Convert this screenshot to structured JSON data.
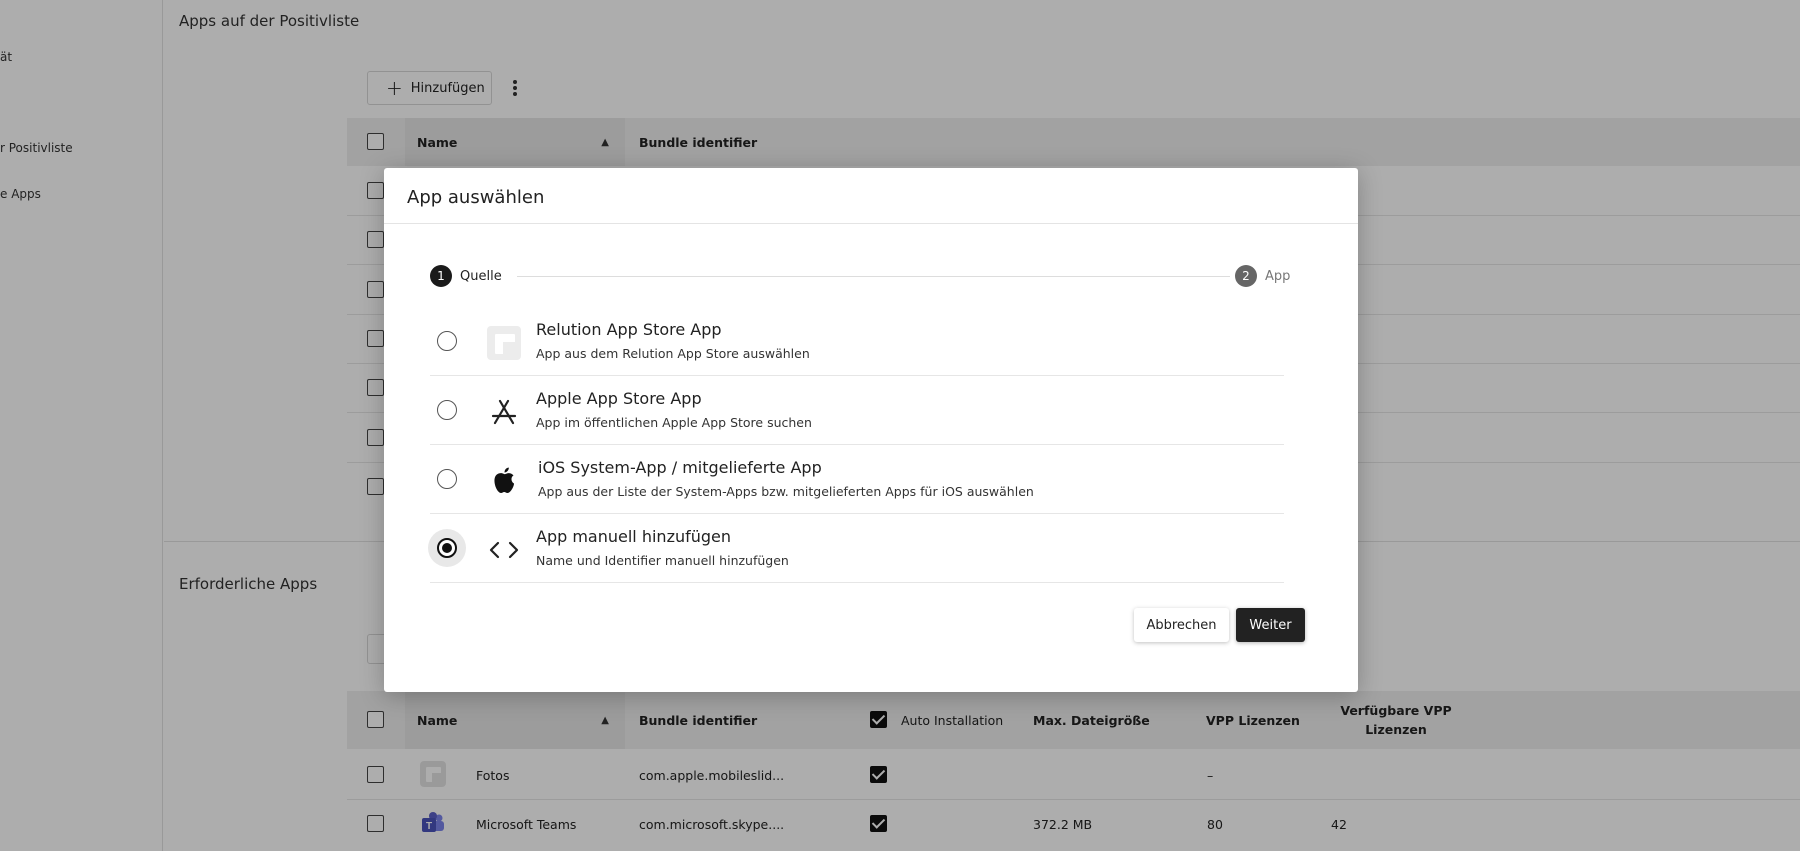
{
  "sidebar": {
    "items": [
      {
        "label": "ät"
      },
      {
        "label": "r Positivliste"
      },
      {
        "label": "e Apps"
      }
    ]
  },
  "positivliste": {
    "title": "Apps auf der Positivliste",
    "add_label": "Hinzufügen",
    "columns": {
      "name": "Name",
      "bundle": "Bundle identifier"
    }
  },
  "erforderliche": {
    "title": "Erforderliche Apps",
    "columns": {
      "name": "Name",
      "bundle": "Bundle identifier",
      "auto": "Auto Installation",
      "size": "Max. Dateigröße",
      "vpp": "VPP Lizenzen",
      "vpp_avail_1": "Verfügbare VPP",
      "vpp_avail_2": "Lizenzen"
    },
    "rows": [
      {
        "name": "Fotos",
        "bundle": "com.apple.mobileslid...",
        "auto": true,
        "size": "",
        "vpp": "–",
        "vpp_avail": ""
      },
      {
        "name": "Microsoft Teams",
        "bundle": "com.microsoft.skype....",
        "auto": true,
        "size": "372.2 MB",
        "vpp": "80",
        "vpp_avail": "42"
      }
    ]
  },
  "dialog": {
    "title": "App auswählen",
    "steps": [
      {
        "num": "1",
        "label": "Quelle"
      },
      {
        "num": "2",
        "label": "App"
      }
    ],
    "options": [
      {
        "title": "Relution App Store App",
        "subtitle": "App aus dem Relution App Store auswählen",
        "icon": "relution-logo-icon"
      },
      {
        "title": "Apple App Store App",
        "subtitle": "App im öffentlichen Apple App Store suchen",
        "icon": "app-store-icon"
      },
      {
        "title": "iOS System-App / mitgelieferte App",
        "subtitle": "App aus der Liste der System-Apps bzw. mitgelieferten Apps für iOS auswählen",
        "icon": "apple-icon"
      },
      {
        "title": "App manuell hinzufügen",
        "subtitle": "Name und Identifier manuell hinzufügen",
        "icon": "code-icon"
      }
    ],
    "selected_option": 3,
    "cancel_label": "Abbrechen",
    "next_label": "Weiter"
  },
  "colors": {
    "primary_dark": "#222222",
    "overlay": "rgba(0,0,0,0.32)",
    "teams_purple": "#5b5fc7"
  }
}
